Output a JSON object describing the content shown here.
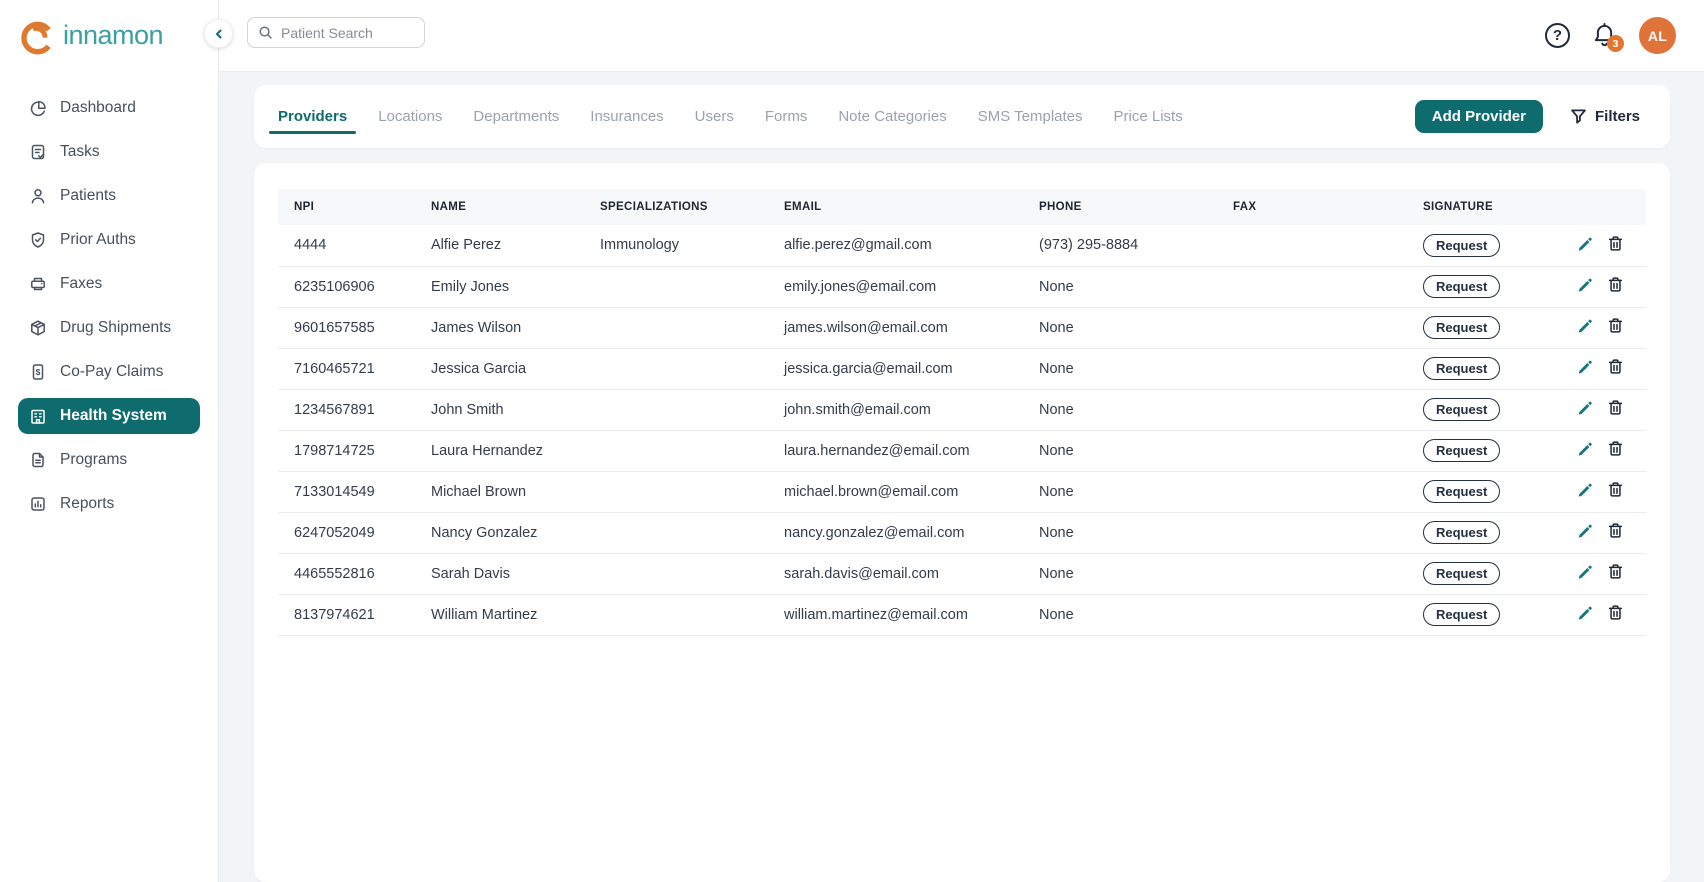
{
  "brand": {
    "name": "innamon",
    "logo_icon": "cinnamon-swirl-icon",
    "colors": {
      "logo_orange": "#dd7a2f",
      "brand_teal": "#3aa0a0"
    }
  },
  "colors": {
    "accent_teal": "#0e6b6e",
    "accent_orange": "#e2762f",
    "dark_navy": "#1e2a3c",
    "page_background": "#f3f4f6"
  },
  "topbar": {
    "search_placeholder": "Patient Search",
    "notification_count": "3",
    "avatar_initials": "AL"
  },
  "sidebar": {
    "items": [
      {
        "label": "Dashboard",
        "icon": "pie-chart-icon",
        "active": false
      },
      {
        "label": "Tasks",
        "icon": "clipboard-check-icon",
        "active": false
      },
      {
        "label": "Patients",
        "icon": "person-icon",
        "active": false
      },
      {
        "label": "Prior Auths",
        "icon": "shield-check-icon",
        "active": false
      },
      {
        "label": "Faxes",
        "icon": "fax-icon",
        "active": false
      },
      {
        "label": "Drug Shipments",
        "icon": "package-icon",
        "active": false
      },
      {
        "label": "Co-Pay Claims",
        "icon": "dollar-doc-icon",
        "active": false
      },
      {
        "label": "Health System",
        "icon": "hospital-icon",
        "active": true
      },
      {
        "label": "Programs",
        "icon": "file-text-icon",
        "active": false
      },
      {
        "label": "Reports",
        "icon": "bar-chart-icon",
        "active": false
      }
    ]
  },
  "tabs": [
    {
      "label": "Providers",
      "active": true
    },
    {
      "label": "Locations",
      "active": false
    },
    {
      "label": "Departments",
      "active": false
    },
    {
      "label": "Insurances",
      "active": false
    },
    {
      "label": "Users",
      "active": false
    },
    {
      "label": "Forms",
      "active": false
    },
    {
      "label": "Note Categories",
      "active": false
    },
    {
      "label": "SMS Templates",
      "active": false
    },
    {
      "label": "Price Lists",
      "active": false
    }
  ],
  "actions": {
    "add_provider_label": "Add Provider",
    "filters_label": "Filters"
  },
  "table": {
    "columns": [
      "NPI",
      "NAME",
      "SPECIALIZATIONS",
      "EMAIL",
      "PHONE",
      "FAX",
      "SIGNATURE"
    ],
    "signature_button_label": "Request",
    "rows": [
      {
        "npi": "4444",
        "name": "Alfie Perez",
        "specializations": "Immunology",
        "email": "alfie.perez@gmail.com",
        "phone": "(973) 295-8884",
        "fax": ""
      },
      {
        "npi": "6235106906",
        "name": "Emily Jones",
        "specializations": "",
        "email": "emily.jones@email.com",
        "phone": "None",
        "fax": ""
      },
      {
        "npi": "9601657585",
        "name": "James Wilson",
        "specializations": "",
        "email": "james.wilson@email.com",
        "phone": "None",
        "fax": ""
      },
      {
        "npi": "7160465721",
        "name": "Jessica Garcia",
        "specializations": "",
        "email": "jessica.garcia@email.com",
        "phone": "None",
        "fax": ""
      },
      {
        "npi": "1234567891",
        "name": "John Smith",
        "specializations": "",
        "email": "john.smith@email.com",
        "phone": "None",
        "fax": ""
      },
      {
        "npi": "1798714725",
        "name": "Laura Hernandez",
        "specializations": "",
        "email": "laura.hernandez@email.com",
        "phone": "None",
        "fax": ""
      },
      {
        "npi": "7133014549",
        "name": "Michael Brown",
        "specializations": "",
        "email": "michael.brown@email.com",
        "phone": "None",
        "fax": ""
      },
      {
        "npi": "6247052049",
        "name": "Nancy Gonzalez",
        "specializations": "",
        "email": "nancy.gonzalez@email.com",
        "phone": "None",
        "fax": ""
      },
      {
        "npi": "4465552816",
        "name": "Sarah Davis",
        "specializations": "",
        "email": "sarah.davis@email.com",
        "phone": "None",
        "fax": ""
      },
      {
        "npi": "8137974621",
        "name": "William Martinez",
        "specializations": "",
        "email": "william.martinez@email.com",
        "phone": "None",
        "fax": ""
      }
    ]
  }
}
